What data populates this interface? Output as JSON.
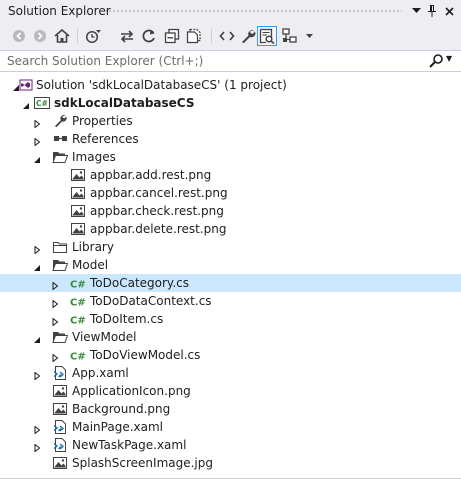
{
  "window": {
    "title": "Solution Explorer"
  },
  "search": {
    "placeholder": "Search Solution Explorer (Ctrl+;)"
  },
  "tree": [
    {
      "label": "Solution 'sdkLocalDatabaseCS' (1 project)",
      "icon": "solution-icon",
      "indent": 0,
      "expander": "expanded",
      "bold": false,
      "selected": false
    },
    {
      "label": "sdkLocalDatabaseCS",
      "icon": "csharp-project-icon",
      "indent": 1,
      "expander": "expanded",
      "bold": true,
      "selected": false
    },
    {
      "label": "Properties",
      "icon": "wrench-icon",
      "indent": 2,
      "expander": "collapsed",
      "bold": false,
      "selected": false
    },
    {
      "label": "References",
      "icon": "references-icon",
      "indent": 2,
      "expander": "collapsed",
      "bold": false,
      "selected": false
    },
    {
      "label": "Images",
      "icon": "folder-open-icon",
      "indent": 2,
      "expander": "expanded",
      "bold": false,
      "selected": false
    },
    {
      "label": "appbar.add.rest.png",
      "icon": "image-file-icon",
      "indent": 3,
      "expander": "none",
      "bold": false,
      "selected": false
    },
    {
      "label": "appbar.cancel.rest.png",
      "icon": "image-file-icon",
      "indent": 3,
      "expander": "none",
      "bold": false,
      "selected": false
    },
    {
      "label": "appbar.check.rest.png",
      "icon": "image-file-icon",
      "indent": 3,
      "expander": "none",
      "bold": false,
      "selected": false
    },
    {
      "label": "appbar.delete.rest.png",
      "icon": "image-file-icon",
      "indent": 3,
      "expander": "none",
      "bold": false,
      "selected": false
    },
    {
      "label": "Library",
      "icon": "folder-icon",
      "indent": 2,
      "expander": "collapsed",
      "bold": false,
      "selected": false
    },
    {
      "label": "Model",
      "icon": "folder-open-icon",
      "indent": 2,
      "expander": "expanded",
      "bold": false,
      "selected": false
    },
    {
      "label": "ToDoCategory.cs",
      "icon": "csharp-file-icon",
      "indent": 3,
      "expander": "collapsed",
      "bold": false,
      "selected": true
    },
    {
      "label": "ToDoDataContext.cs",
      "icon": "csharp-file-icon",
      "indent": 3,
      "expander": "collapsed",
      "bold": false,
      "selected": false
    },
    {
      "label": "ToDoItem.cs",
      "icon": "csharp-file-icon",
      "indent": 3,
      "expander": "collapsed",
      "bold": false,
      "selected": false
    },
    {
      "label": "ViewModel",
      "icon": "folder-open-icon",
      "indent": 2,
      "expander": "expanded",
      "bold": false,
      "selected": false
    },
    {
      "label": "ToDoViewModel.cs",
      "icon": "csharp-file-icon",
      "indent": 3,
      "expander": "collapsed",
      "bold": false,
      "selected": false
    },
    {
      "label": "App.xaml",
      "icon": "xaml-file-icon",
      "indent": 2,
      "expander": "collapsed",
      "bold": false,
      "selected": false
    },
    {
      "label": "ApplicationIcon.png",
      "icon": "image-file-icon",
      "indent": 2,
      "expander": "none",
      "bold": false,
      "selected": false
    },
    {
      "label": "Background.png",
      "icon": "image-file-icon",
      "indent": 2,
      "expander": "none",
      "bold": false,
      "selected": false
    },
    {
      "label": "MainPage.xaml",
      "icon": "xaml-file-icon",
      "indent": 2,
      "expander": "collapsed",
      "bold": false,
      "selected": false
    },
    {
      "label": "NewTaskPage.xaml",
      "icon": "xaml-file-icon",
      "indent": 2,
      "expander": "collapsed",
      "bold": false,
      "selected": false
    },
    {
      "label": "SplashScreenImage.jpg",
      "icon": "image-file-icon",
      "indent": 2,
      "expander": "none",
      "bold": false,
      "selected": false
    }
  ],
  "colors": {
    "chrome_background": "#eeeef2",
    "selection": "#cce8ff",
    "csharp_green": "#388a34",
    "folder": "#dcb67a"
  }
}
